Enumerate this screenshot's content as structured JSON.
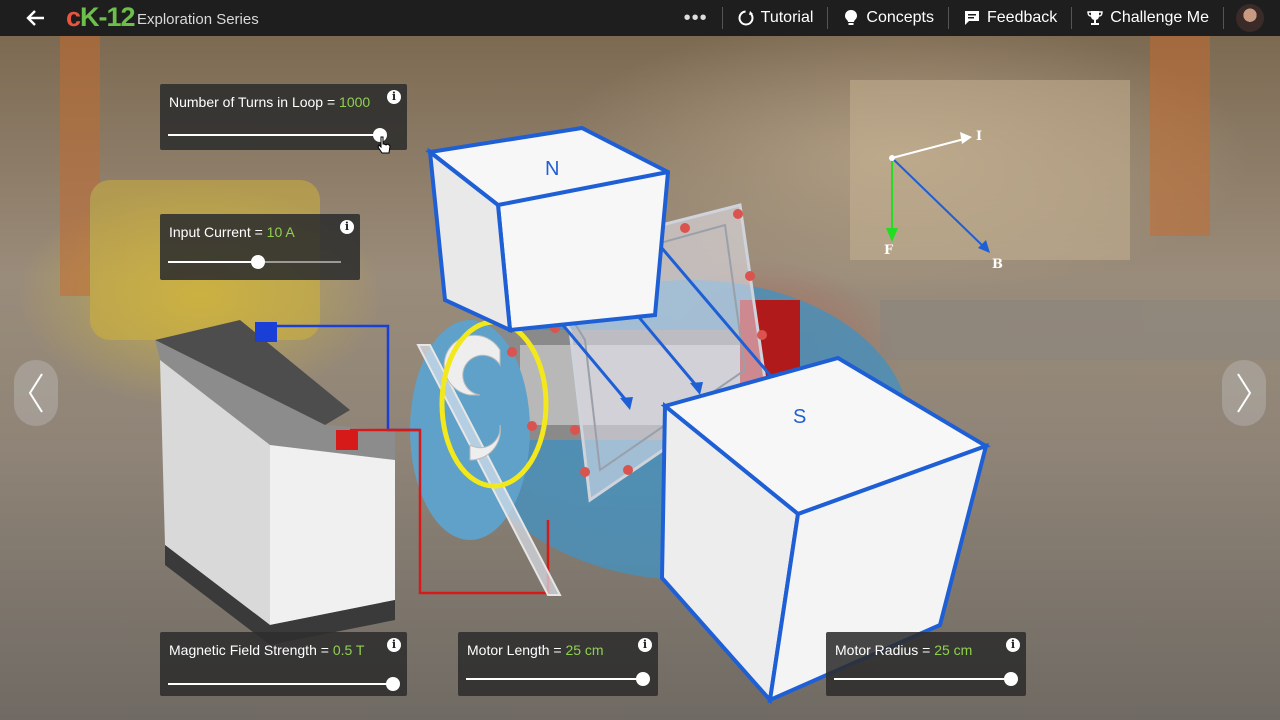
{
  "header": {
    "logo_c": "c",
    "logo_k": "K-12",
    "series": "Exploration Series",
    "more_label": "•••",
    "menu": [
      {
        "label": "Tutorial",
        "icon": "tutorial-icon"
      },
      {
        "label": "Concepts",
        "icon": "lightbulb-icon"
      },
      {
        "label": "Feedback",
        "icon": "feedback-icon"
      },
      {
        "label": "Challenge Me",
        "icon": "trophy-icon"
      }
    ]
  },
  "controls": {
    "turns": {
      "label": "Number of Turns in Loop = ",
      "value": "1000",
      "level": 1.0
    },
    "current": {
      "label": "Input Current = ",
      "value": "10 A",
      "level": 0.52
    },
    "field": {
      "label": "Magnetic Field Strength = ",
      "value": "0.5 T",
      "level": 1.0
    },
    "length": {
      "label": "Motor Length = ",
      "value": "25 cm",
      "level": 1.0
    },
    "radius": {
      "label": "Motor Radius = ",
      "value": "25 cm",
      "level": 1.0
    },
    "info": "i"
  },
  "scene": {
    "magnet_north": "N",
    "magnet_south": "S",
    "vector_i": "I",
    "vector_f": "F",
    "vector_b": "B"
  },
  "colors": {
    "accent_green": "#8fd14f",
    "magnet_outline": "#1f5fd6",
    "wire_positive": "#d61a1a",
    "wire_negative": "#1a3fd6",
    "highlight": "#f2e81c"
  }
}
